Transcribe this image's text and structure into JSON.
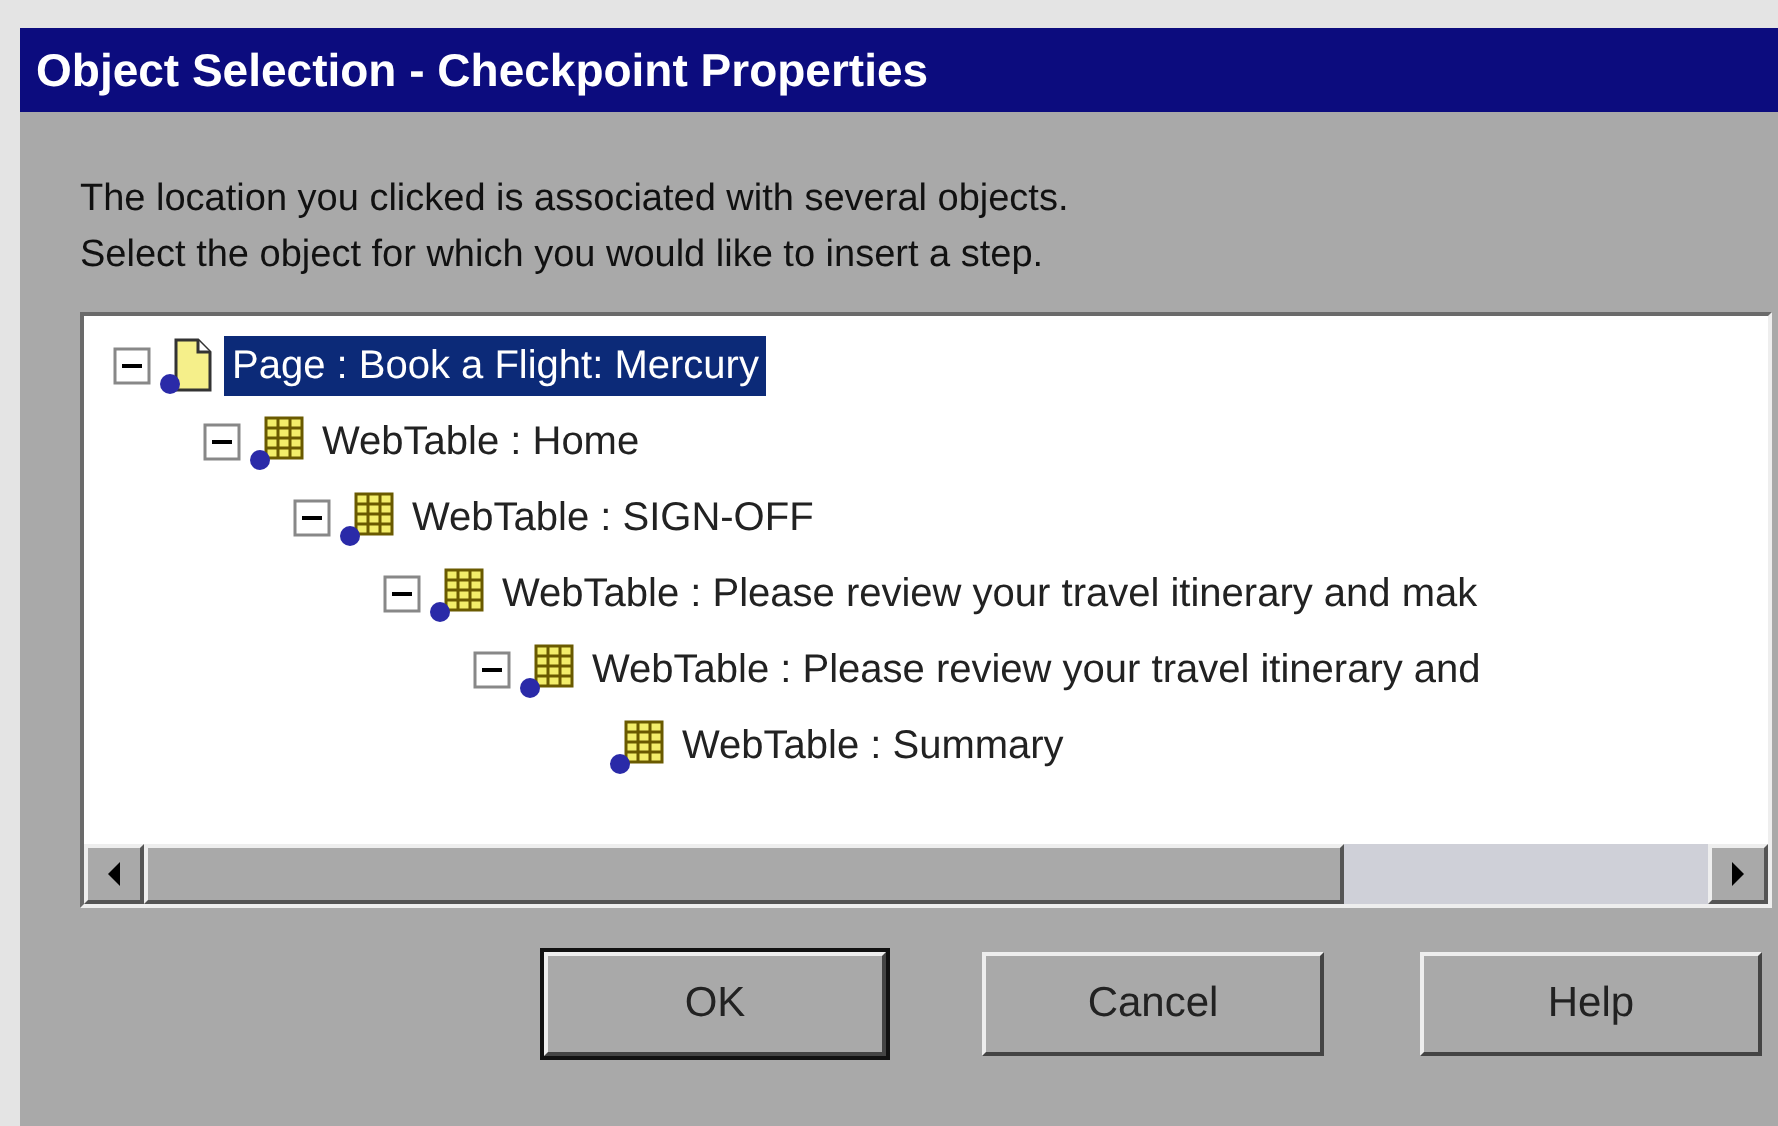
{
  "window": {
    "title": "Object Selection - Checkpoint Properties"
  },
  "instructions": [
    "The location you clicked is associated with several objects.",
    "Select the object for which you would like to insert a step."
  ],
  "tree": [
    {
      "kind": "page",
      "label": "Page : Book a Flight: Mercury",
      "selected": true,
      "expanded": true,
      "children": [
        {
          "kind": "table",
          "label": "WebTable : Home",
          "selected": false,
          "expanded": true,
          "children": [
            {
              "kind": "table",
              "label": "WebTable : SIGN-OFF",
              "selected": false,
              "expanded": true,
              "children": [
                {
                  "kind": "table",
                  "label": "WebTable : Please review your travel itinerary and mak",
                  "selected": false,
                  "expanded": true,
                  "children": [
                    {
                      "kind": "table",
                      "label": "WebTable : Please review your travel itinerary and",
                      "selected": false,
                      "expanded": true,
                      "children": [
                        {
                          "kind": "table",
                          "label": "WebTable : Summary",
                          "selected": false
                        }
                      ]
                    }
                  ]
                }
              ]
            }
          ]
        }
      ]
    }
  ],
  "buttons": [
    {
      "label": "OK",
      "default": true
    },
    {
      "label": "Cancel",
      "default": false
    },
    {
      "label": "Help",
      "default": false
    }
  ]
}
